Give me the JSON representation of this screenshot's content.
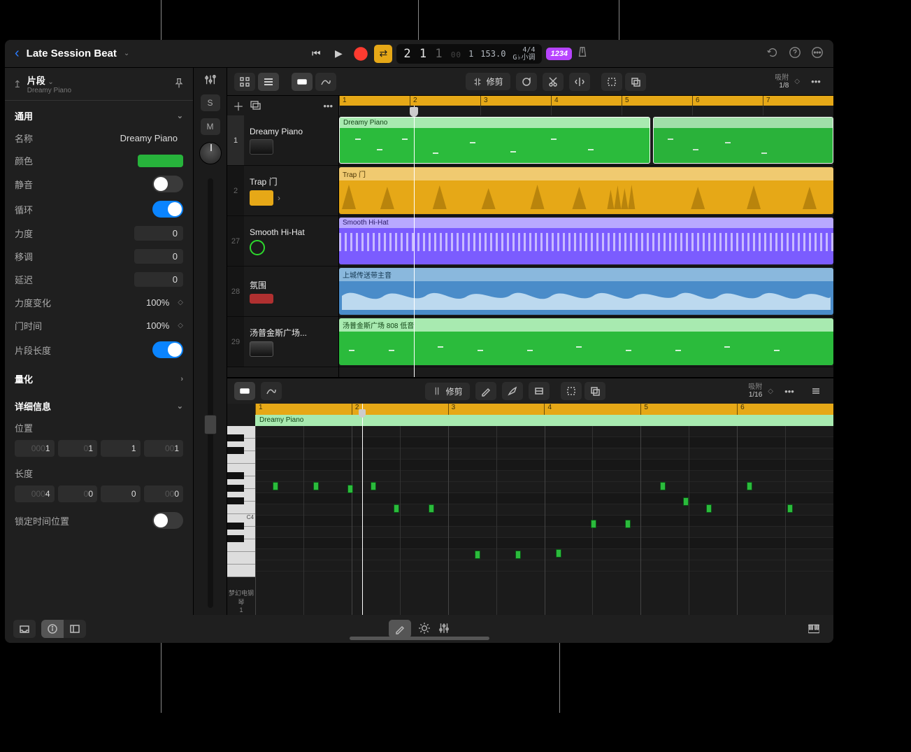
{
  "project": {
    "title": "Late Session Beat"
  },
  "transport": {
    "position": "2 1 1 00",
    "bar_sub": "1",
    "tempo": "153.0",
    "sig": "4/4",
    "key": "G♭小调",
    "count_in": "1234"
  },
  "inspector": {
    "header_title": "片段",
    "header_sub": "Dreamy Piano",
    "section_general": "通用",
    "name_label": "名称",
    "name_value": "Dreamy Piano",
    "color_label": "颜色",
    "mute_label": "静音",
    "loop_label": "循环",
    "velocity_label": "力度",
    "velocity_value": "0",
    "transpose_label": "移调",
    "transpose_value": "0",
    "delay_label": "延迟",
    "delay_value": "0",
    "velscale_label": "力度变化",
    "velscale_value": "100%",
    "gate_label": "门时间",
    "gate_value": "100%",
    "cliplen_label": "片段长度",
    "quantize_label": "量化",
    "details_label": "详细信息",
    "position_label": "位置",
    "position_vals": [
      "0001",
      "01",
      "1",
      "001"
    ],
    "length_label": "长度",
    "length_vals": [
      "0004",
      "0",
      "0",
      "000"
    ],
    "locktime_label": "锁定时间位置"
  },
  "fader": {
    "solo": "S",
    "mute": "M"
  },
  "track_toolbar": {
    "trim_label": "修剪",
    "snap_title": "吸附",
    "snap_value": "1/8"
  },
  "ruler_bars": [
    "1",
    "2",
    "3",
    "4",
    "5",
    "6",
    "7"
  ],
  "tracks": [
    {
      "num": "1",
      "name": "Dreamy Piano",
      "icon": "keyboard",
      "sel": true
    },
    {
      "num": "2",
      "name": "Trap 门",
      "icon": "drum"
    },
    {
      "num": "27",
      "name": "Smooth Hi-Hat",
      "icon": "hihat"
    },
    {
      "num": "28",
      "name": "氛围",
      "icon": "synth"
    },
    {
      "num": "29",
      "name": "汤普金斯广场...",
      "icon": "bass"
    }
  ],
  "regions": {
    "r1a": "Dreamy Piano",
    "r1b": "",
    "r2": "Trap 门",
    "r3": "Smooth Hi-Hat",
    "r4": "上城传送带主音",
    "r5": "汤普金斯广场 808 低音"
  },
  "editor_toolbar": {
    "trim_label": "修剪",
    "snap_title": "吸附",
    "snap_value": "1/16"
  },
  "editor": {
    "region_label": "Dreamy Piano",
    "piano_label_top": "梦幻电钢琴",
    "piano_label_bottom": "1",
    "c4_label": "C4",
    "ruler_bars": [
      "1",
      "2",
      "3",
      "4",
      "5",
      "6"
    ]
  }
}
